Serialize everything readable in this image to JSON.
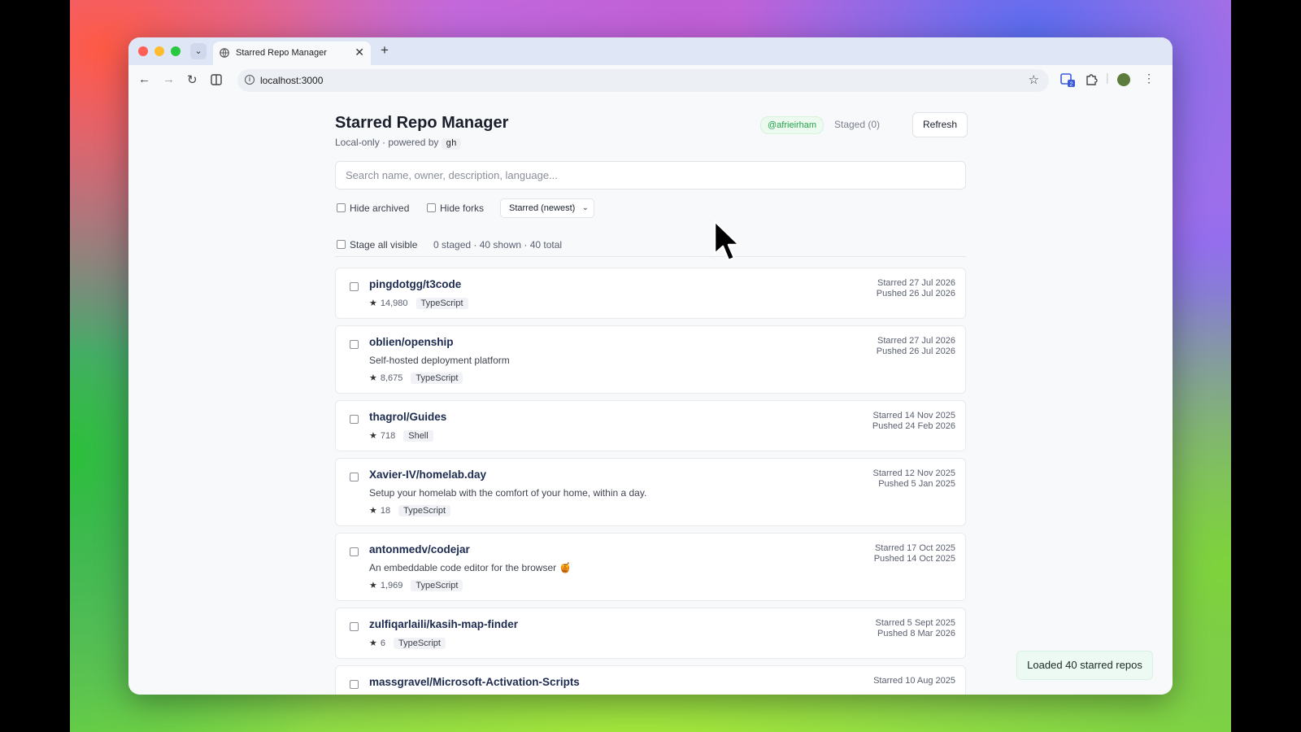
{
  "browser": {
    "tab_title": "Starred Repo Manager",
    "tab_close": "✕",
    "new_tab": "+",
    "url": "localhost:3000"
  },
  "header": {
    "title": "Starred Repo Manager",
    "subtitle": "Local-only · powered by",
    "subtitle_code": "gh",
    "user": "@afrieirham",
    "staged_label": "Staged (0)",
    "refresh_label": "Refresh"
  },
  "search": {
    "placeholder": "Search name, owner, description, language..."
  },
  "filters": {
    "hide_archived": "Hide archived",
    "hide_forks": "Hide forks",
    "sort_selected": "Starred (newest)"
  },
  "stage": {
    "stage_all_label": "Stage all visible",
    "summary": "0 staged · 40 shown · 40 total"
  },
  "repos": [
    {
      "name": "pingdotgg/t3code",
      "description": "",
      "stars": "14,980",
      "language": "TypeScript",
      "starred": "Starred 27 Jul 2026",
      "pushed": "Pushed 26 Jul 2026"
    },
    {
      "name": "oblien/openship",
      "description": "Self-hosted deployment platform",
      "stars": "8,675",
      "language": "TypeScript",
      "starred": "Starred 27 Jul 2026",
      "pushed": "Pushed 26 Jul 2026"
    },
    {
      "name": "thagrol/Guides",
      "description": "",
      "stars": "718",
      "language": "Shell",
      "starred": "Starred 14 Nov 2025",
      "pushed": "Pushed 24 Feb 2026"
    },
    {
      "name": "Xavier-IV/homelab.day",
      "description": "Setup your homelab with the comfort of your home, within a day.",
      "stars": "18",
      "language": "TypeScript",
      "starred": "Starred 12 Nov 2025",
      "pushed": "Pushed 5 Jan 2025"
    },
    {
      "name": "antonmedv/codejar",
      "description": "An embeddable code editor for the browser 🍯",
      "stars": "1,969",
      "language": "TypeScript",
      "starred": "Starred 17 Oct 2025",
      "pushed": "Pushed 14 Oct 2025"
    },
    {
      "name": "zulfiqarlaili/kasih-map-finder",
      "description": "",
      "stars": "6",
      "language": "TypeScript",
      "starred": "Starred 5 Sept 2025",
      "pushed": "Pushed 8 Mar 2026"
    },
    {
      "name": "massgravel/Microsoft-Activation-Scripts",
      "description": "",
      "stars": "",
      "language": "",
      "starred": "Starred 10 Aug 2025",
      "pushed": ""
    }
  ],
  "toast": "Loaded 40 starred repos",
  "colors": {
    "accent_green": "#26a34a",
    "repo_name": "#1d2b4f"
  }
}
